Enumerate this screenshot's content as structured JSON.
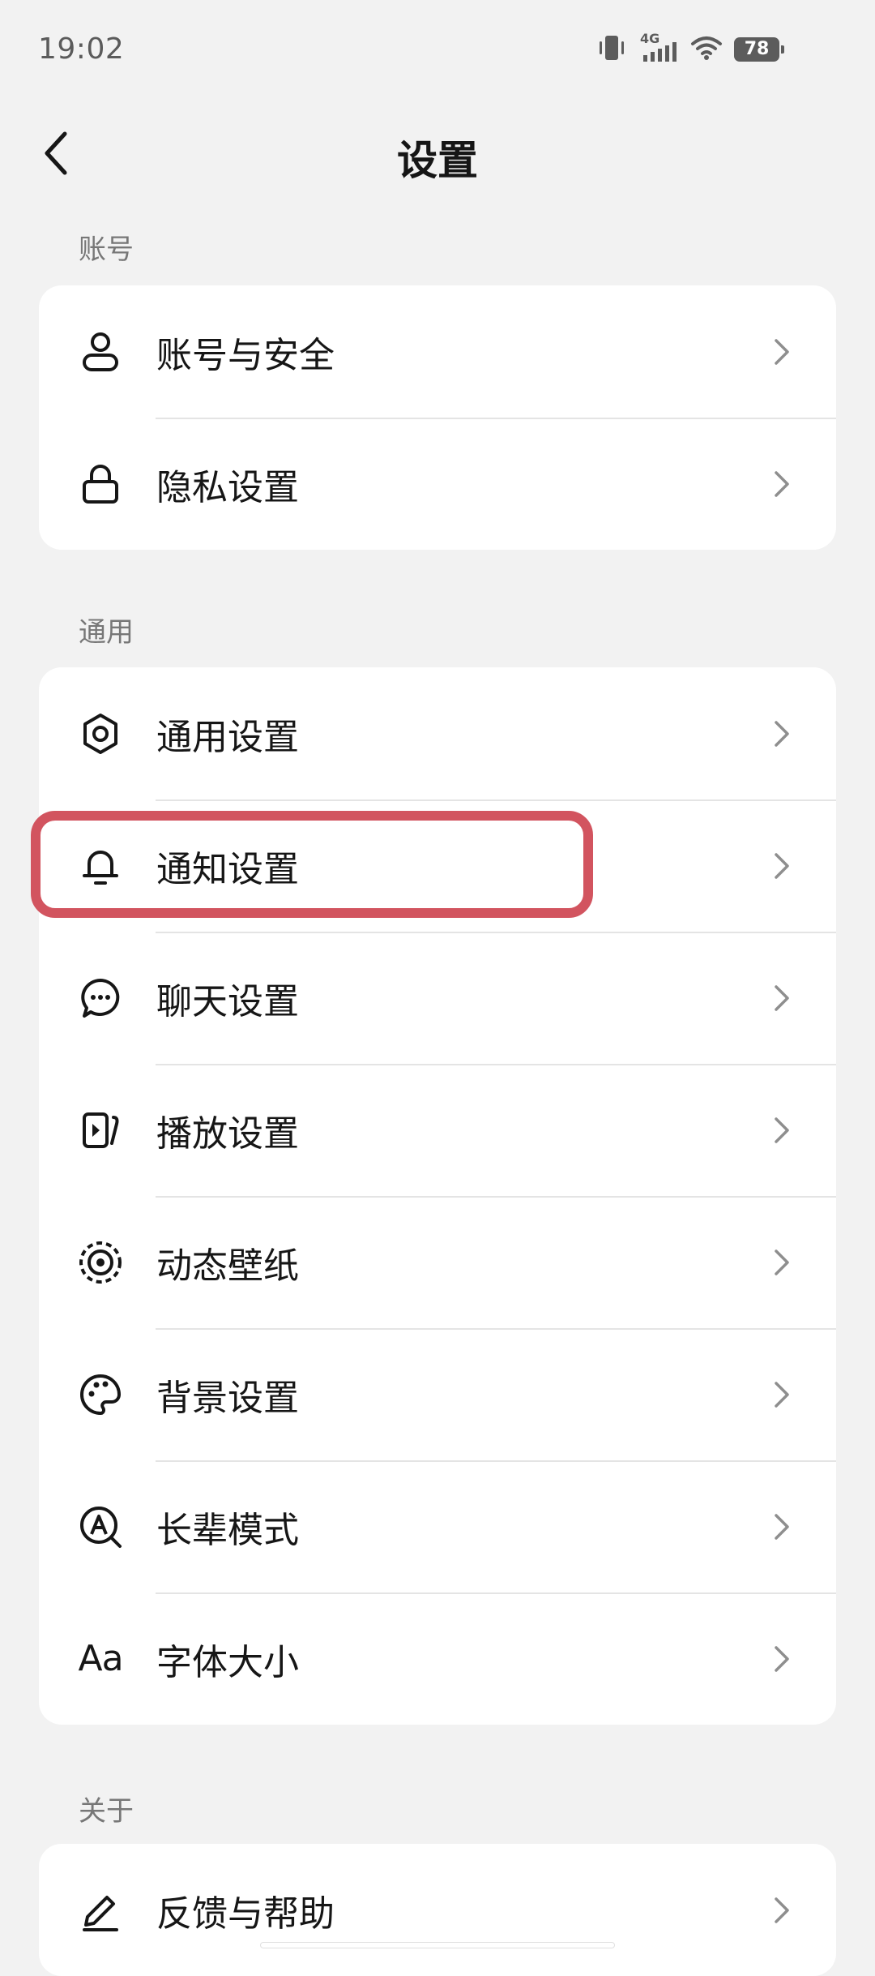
{
  "status_bar": {
    "time": "19:02",
    "network": "4G",
    "battery": "78"
  },
  "header": {
    "title": "设置"
  },
  "sections": [
    {
      "title": "账号",
      "items": [
        {
          "label": "账号与安全",
          "icon": "user-icon"
        },
        {
          "label": "隐私设置",
          "icon": "lock-icon"
        }
      ]
    },
    {
      "title": "通用",
      "items": [
        {
          "label": "通用设置",
          "icon": "gear-icon"
        },
        {
          "label": "通知设置",
          "icon": "bell-icon"
        },
        {
          "label": "聊天设置",
          "icon": "chat-icon"
        },
        {
          "label": "播放设置",
          "icon": "play-icon"
        },
        {
          "label": "动态壁纸",
          "icon": "live-wallpaper-icon"
        },
        {
          "label": "背景设置",
          "icon": "palette-icon"
        },
        {
          "label": "长辈模式",
          "icon": "elder-mode-icon"
        },
        {
          "label": "字体大小",
          "icon": "font-size-icon",
          "glyph": "Aa"
        }
      ]
    },
    {
      "title": "关于",
      "items": [
        {
          "label": "反馈与帮助",
          "icon": "pencil-icon"
        }
      ]
    }
  ],
  "colors": {
    "background": "#f2f2f2",
    "card": "#ffffff",
    "highlight": "#d2545f"
  }
}
